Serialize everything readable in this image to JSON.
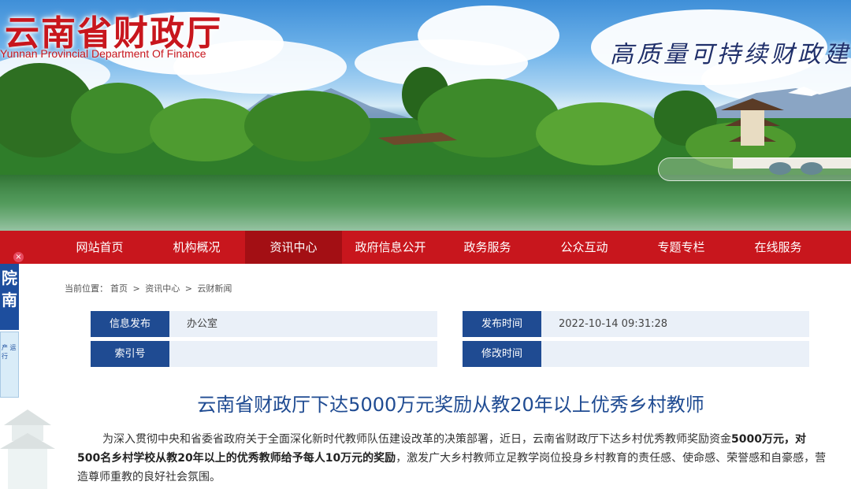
{
  "header": {
    "title": "云南省财政厅",
    "subtitle": "Yunnan Provincial Department Of Finance",
    "slogan": "高质量可持续财政建"
  },
  "nav": {
    "items": [
      {
        "label": "网站首页"
      },
      {
        "label": "机构概况"
      },
      {
        "label": "资讯中心",
        "active": true
      },
      {
        "label": "政府信息公开"
      },
      {
        "label": "政务服务"
      },
      {
        "label": "公众互动"
      },
      {
        "label": "专题专栏"
      },
      {
        "label": "在线服务"
      }
    ]
  },
  "float_ad": {
    "close": "×",
    "top_text": "院 南",
    "bottom_text": "产 运行"
  },
  "breadcrumb": {
    "prefix": "当前位置：",
    "items": [
      "首页",
      "资讯中心",
      "云财新闻"
    ],
    "separator": ">"
  },
  "info": {
    "publisher_label": "信息发布",
    "publisher_value": "办公室",
    "date_label": "发布时间",
    "date_value": "2022-10-14 09:31:28",
    "index_label": "索引号",
    "index_value": "",
    "modified_label": "修改时间",
    "modified_value": ""
  },
  "article": {
    "title": "云南省财政厅下达5000万元奖励从教20年以上优秀乡村教师",
    "para_part1": "为深入贯彻中央和省委省政府关于全面深化新时代教师队伍建设改革的决策部署，近日，云南省财政厅下达乡村优秀教师奖励资金",
    "para_bold": "5000万元，对500名乡村学校从教20年以上的优秀教师给予每人10万元的奖励",
    "para_part2": "，激发广大乡村教师立足教学岗位投身乡村教育的责任感、使命感、荣誉感和自豪感，营造尊师重教的良好社会氛围。"
  },
  "colors": {
    "brand_red": "#c8161d",
    "nav_active": "#a30f14",
    "label_blue": "#1f4b92",
    "value_bg": "#eaf0f8",
    "title_blue": "#1f4b92"
  }
}
